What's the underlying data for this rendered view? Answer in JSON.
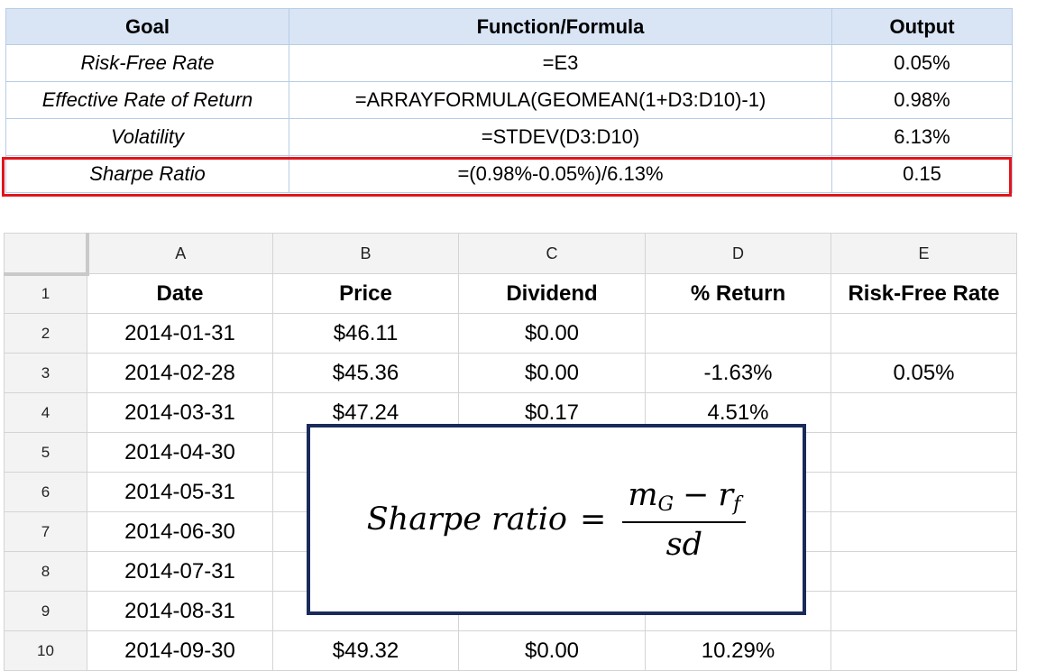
{
  "summary": {
    "headers": [
      "Goal",
      "Function/Formula",
      "Output"
    ],
    "rows": [
      {
        "goal": "Risk-Free Rate",
        "formula": "=E3",
        "output": "0.05%"
      },
      {
        "goal": "Effective Rate of Return",
        "formula": "=ARRAYFORMULA(GEOMEAN(1+D3:D10)-1)",
        "output": "0.98%"
      },
      {
        "goal": "Volatility",
        "formula": "=STDEV(D3:D10)",
        "output": "6.13%"
      },
      {
        "goal": "Sharpe Ratio",
        "formula": "=(0.98%-0.05%)/6.13%",
        "output": "0.15"
      }
    ],
    "highlight_color": "#e3141c",
    "header_color": "#d9e5f5"
  },
  "sheet": {
    "column_letters": [
      "A",
      "B",
      "C",
      "D",
      "E"
    ],
    "row_numbers": [
      "1",
      "2",
      "3",
      "4",
      "5",
      "6",
      "7",
      "8",
      "9",
      "10"
    ],
    "header_row": [
      "Date",
      "Price",
      "Dividend",
      "% Return",
      "Risk-Free Rate"
    ],
    "rows": [
      [
        "2014-01-31",
        "$46.11",
        "$0.00",
        "",
        ""
      ],
      [
        "2014-02-28",
        "$45.36",
        "$0.00",
        "-1.63%",
        "0.05%"
      ],
      [
        "2014-03-31",
        "$47.24",
        "$0.17",
        "4.51%",
        ""
      ],
      [
        "2014-04-30",
        "",
        "",
        "",
        ""
      ],
      [
        "2014-05-31",
        "",
        "",
        "",
        ""
      ],
      [
        "2014-06-30",
        "",
        "",
        "",
        ""
      ],
      [
        "2014-07-31",
        "",
        "",
        "",
        ""
      ],
      [
        "2014-08-31",
        "",
        "",
        "",
        ""
      ],
      [
        "2014-09-30",
        "$49.32",
        "$0.00",
        "10.29%",
        ""
      ]
    ]
  },
  "formula": {
    "lhs": "Sharpe ratio",
    "eq": "=",
    "num_m": "m",
    "num_m_sub": "G",
    "minus": "−",
    "num_r": "r",
    "num_r_sub": "f",
    "den": "sd",
    "border_color": "#1a2b5a"
  }
}
